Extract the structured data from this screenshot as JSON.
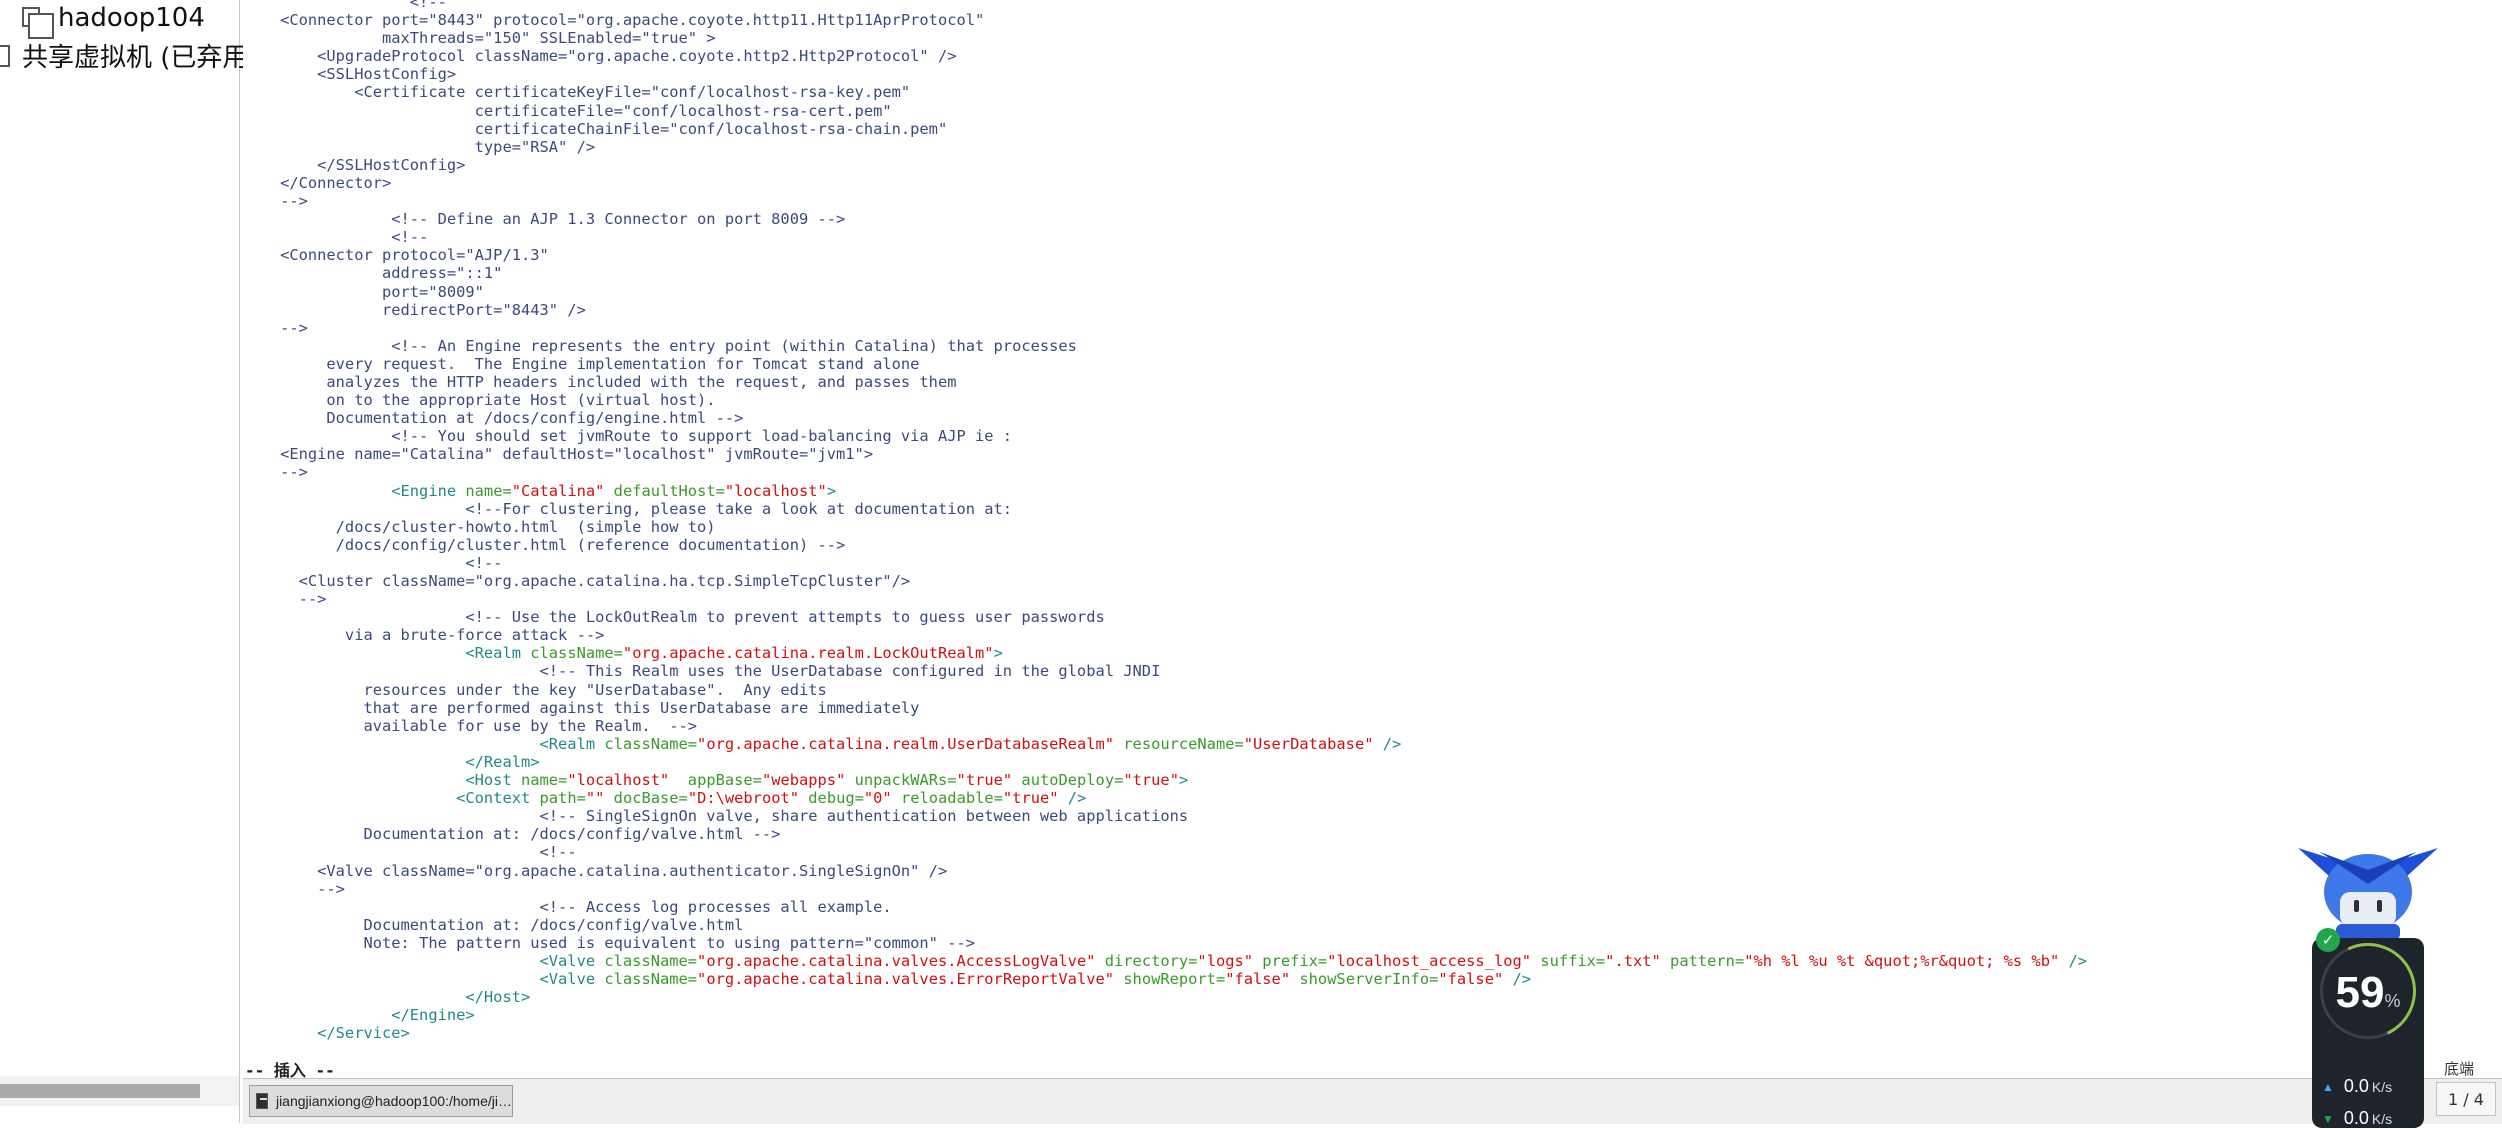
{
  "sidebar": {
    "items": [
      {
        "label": "hadoop104"
      },
      {
        "label": "共享虚拟机 (已弃用)"
      }
    ]
  },
  "editor": {
    "mode_label": "-- 插入 --"
  },
  "taskbar": {
    "task_label": "jiangjianxiong@hadoop100:/home/ji…",
    "tray_text": "底端",
    "page_indicator": "1 / 4"
  },
  "net_widget": {
    "percent": "59",
    "percent_unit": "%",
    "upload": "0.0",
    "download": "0.0",
    "rate_unit": "K/s",
    "accent_color": "#22a64a"
  },
  "code_lines": [
    [
      [
        "cm",
        "                  <!--"
      ]
    ],
    [
      [
        "cm",
        "    <Connector port=\"8443\" protocol=\"org.apache.coyote.http11.Http11AprProtocol\""
      ]
    ],
    [
      [
        "cm",
        "               maxThreads=\"150\" SSLEnabled=\"true\" >"
      ]
    ],
    [
      [
        "cm",
        "        <UpgradeProtocol className=\"org.apache.coyote.http2.Http2Protocol\" />"
      ]
    ],
    [
      [
        "cm",
        "        <SSLHostConfig>"
      ]
    ],
    [
      [
        "cm",
        "            <Certificate certificateKeyFile=\"conf/localhost-rsa-key.pem\""
      ]
    ],
    [
      [
        "cm",
        "                         certificateFile=\"conf/localhost-rsa-cert.pem\""
      ]
    ],
    [
      [
        "cm",
        "                         certificateChainFile=\"conf/localhost-rsa-chain.pem\""
      ]
    ],
    [
      [
        "cm",
        "                         type=\"RSA\" />"
      ]
    ],
    [
      [
        "cm",
        "        </SSLHostConfig>"
      ]
    ],
    [
      [
        "cm",
        "    </Connector>"
      ]
    ],
    [
      [
        "cm",
        "    -->"
      ]
    ],
    [
      [
        "cm",
        "                <!-- Define an AJP 1.3 Connector on port 8009 -->"
      ]
    ],
    [
      [
        "cm",
        "                <!--"
      ]
    ],
    [
      [
        "cm",
        "    <Connector protocol=\"AJP/1.3\""
      ]
    ],
    [
      [
        "cm",
        "               address=\"::1\""
      ]
    ],
    [
      [
        "cm",
        "               port=\"8009\""
      ]
    ],
    [
      [
        "cm",
        "               redirectPort=\"8443\" />"
      ]
    ],
    [
      [
        "cm",
        "    -->"
      ]
    ],
    [
      [
        "cm",
        "                <!-- An Engine represents the entry point (within Catalina) that processes"
      ]
    ],
    [
      [
        "cm",
        "         every request.  The Engine implementation for Tomcat stand alone"
      ]
    ],
    [
      [
        "cm",
        "         analyzes the HTTP headers included with the request, and passes them"
      ]
    ],
    [
      [
        "cm",
        "         on to the appropriate Host (virtual host)."
      ]
    ],
    [
      [
        "cm",
        "         Documentation at /docs/config/engine.html -->"
      ]
    ],
    [
      [
        "cm",
        "                <!-- You should set jvmRoute to support load-balancing via AJP ie :"
      ]
    ],
    [
      [
        "cm",
        "    <Engine name=\"Catalina\" defaultHost=\"localhost\" jvmRoute=\"jvm1\">"
      ]
    ],
    [
      [
        "cm",
        "    -->"
      ]
    ],
    [
      [
        "tg",
        "                <Engine "
      ],
      [
        "at",
        "name="
      ],
      [
        "vl",
        "\"Catalina\""
      ],
      [
        "at",
        " defaultHost="
      ],
      [
        "vl",
        "\"localhost\""
      ],
      [
        "tg",
        ">"
      ]
    ],
    [
      [
        "cm",
        "                        <!--For clustering, please take a look at documentation at:"
      ]
    ],
    [
      [
        "cm",
        "          /docs/cluster-howto.html  (simple how to)"
      ]
    ],
    [
      [
        "cm",
        "          /docs/config/cluster.html (reference documentation) -->"
      ]
    ],
    [
      [
        "cm",
        "                        <!--"
      ]
    ],
    [
      [
        "cm",
        "      <Cluster className=\"org.apache.catalina.ha.tcp.SimpleTcpCluster\"/>"
      ]
    ],
    [
      [
        "cm",
        "      -->"
      ]
    ],
    [
      [
        "cm",
        "                        <!-- Use the LockOutRealm to prevent attempts to guess user passwords"
      ]
    ],
    [
      [
        "cm",
        "           via a brute-force attack -->"
      ]
    ],
    [
      [
        "tg",
        "                        <Realm "
      ],
      [
        "at",
        "className="
      ],
      [
        "vl",
        "\"org.apache.catalina.realm.LockOutRealm\""
      ],
      [
        "tg",
        ">"
      ]
    ],
    [
      [
        "cm",
        "                                <!-- This Realm uses the UserDatabase configured in the global JNDI"
      ]
    ],
    [
      [
        "cm",
        "             resources under the key \"UserDatabase\".  Any edits"
      ]
    ],
    [
      [
        "cm",
        "             that are performed against this UserDatabase are immediately"
      ]
    ],
    [
      [
        "cm",
        "             available for use by the Realm.  -->"
      ]
    ],
    [
      [
        "tg",
        "                                <Realm "
      ],
      [
        "at",
        "className="
      ],
      [
        "vl",
        "\"org.apache.catalina.realm.UserDatabaseRealm\""
      ],
      [
        "at",
        " resourceName="
      ],
      [
        "vl",
        "\"UserDatabase\""
      ],
      [
        "tg",
        " />"
      ]
    ],
    [
      [
        "tg",
        "                        </Realm>"
      ]
    ],
    [
      [
        "tg",
        "                        <Host "
      ],
      [
        "at",
        "name="
      ],
      [
        "vl",
        "\"localhost\""
      ],
      [
        "at",
        "  appBase="
      ],
      [
        "vl",
        "\"webapps\""
      ],
      [
        "at",
        " unpackWARs="
      ],
      [
        "vl",
        "\"true\""
      ],
      [
        "at",
        " autoDeploy="
      ],
      [
        "vl",
        "\"true\""
      ],
      [
        "tg",
        ">"
      ]
    ],
    [
      [
        "tg",
        "                       <Context "
      ],
      [
        "at",
        "path="
      ],
      [
        "vl",
        "\"\""
      ],
      [
        "at",
        " docBase="
      ],
      [
        "vl",
        "\"D:\\webroot\""
      ],
      [
        "at",
        " debug="
      ],
      [
        "vl",
        "\"0\""
      ],
      [
        "at",
        " reloadable="
      ],
      [
        "vl",
        "\"true\""
      ],
      [
        "tg",
        " />"
      ]
    ],
    [
      [
        "cm",
        "                                <!-- SingleSignOn valve, share authentication between web applications"
      ]
    ],
    [
      [
        "cm",
        "             Documentation at: /docs/config/valve.html -->"
      ]
    ],
    [
      [
        "cm",
        "                                <!--"
      ]
    ],
    [
      [
        "cm",
        "        <Valve className=\"org.apache.catalina.authenticator.SingleSignOn\" />"
      ]
    ],
    [
      [
        "cm",
        "        -->"
      ]
    ],
    [
      [
        "cm",
        "                                <!-- Access log processes all example."
      ]
    ],
    [
      [
        "cm",
        "             Documentation at: /docs/config/valve.html"
      ]
    ],
    [
      [
        "cm",
        "             Note: The pattern used is equivalent to using pattern=\"common\" -->"
      ]
    ],
    [
      [
        "tg",
        "                                <Valve "
      ],
      [
        "at",
        "className="
      ],
      [
        "vl",
        "\"org.apache.catalina.valves.AccessLogValve\""
      ],
      [
        "at",
        " directory="
      ],
      [
        "vl",
        "\"logs\""
      ],
      [
        "at",
        " prefix="
      ],
      [
        "vl",
        "\"localhost_access_log\""
      ],
      [
        "at",
        " suffix="
      ],
      [
        "vl",
        "\".txt\""
      ],
      [
        "at",
        " pattern="
      ],
      [
        "vl",
        "\"%h %l %u %t &quot;%r&quot; %s %b\""
      ],
      [
        "tg",
        " />"
      ]
    ],
    [
      [
        "tg",
        "                                <Valve "
      ],
      [
        "at",
        "className="
      ],
      [
        "vl",
        "\"org.apache.catalina.valves.ErrorReportValve\""
      ],
      [
        "at",
        " showReport="
      ],
      [
        "vl",
        "\"false\""
      ],
      [
        "at",
        " showServerInfo="
      ],
      [
        "vl",
        "\"false\""
      ],
      [
        "tg",
        " />"
      ]
    ],
    [
      [
        "tg",
        "                        </Host>"
      ]
    ],
    [
      [
        "tg",
        "                </Engine>"
      ]
    ],
    [
      [
        "tg",
        "        </Service>"
      ]
    ]
  ]
}
